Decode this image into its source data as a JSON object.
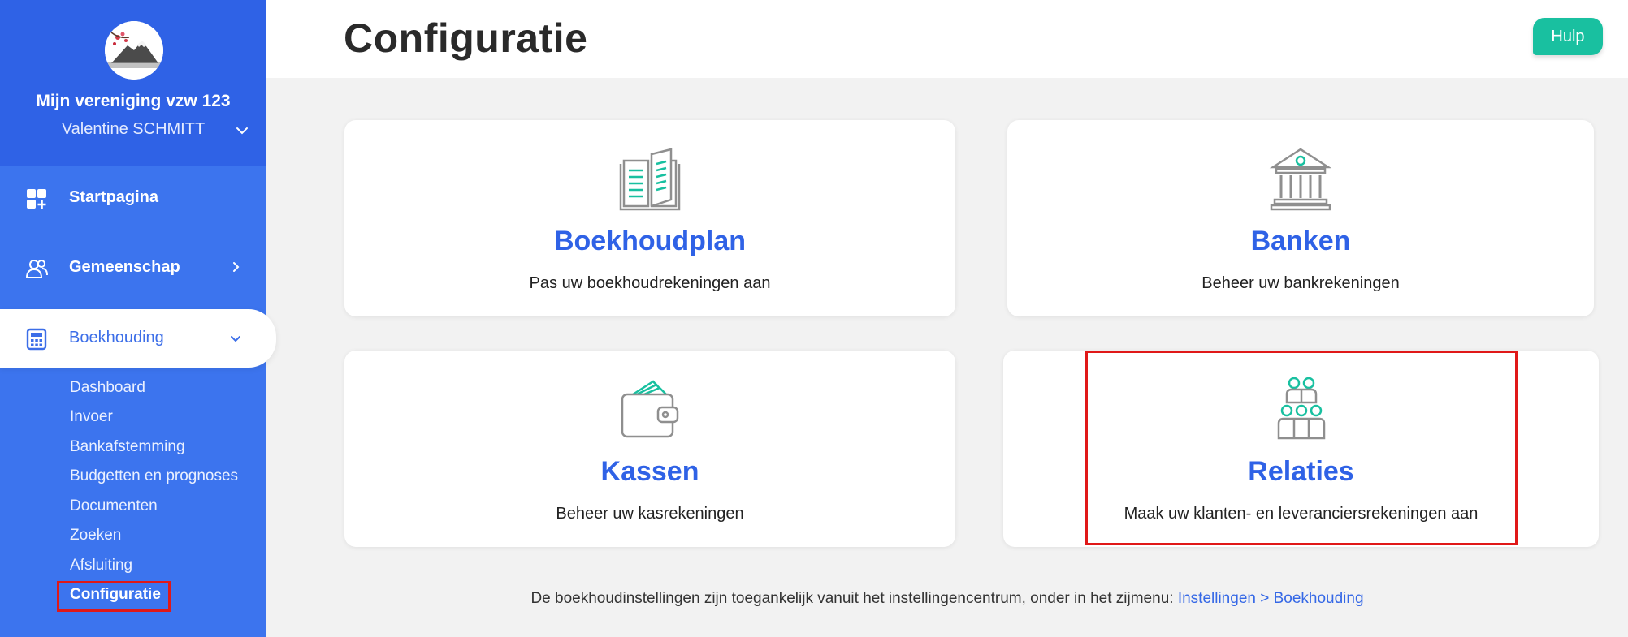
{
  "sidebar": {
    "org_name": "Mijn vereniging vzw 123",
    "user_name": "Valentine SCHMITT",
    "nav": [
      {
        "label": "Startpagina",
        "icon": "dashboard-grid-icon"
      },
      {
        "label": "Gemeenschap",
        "icon": "users-icon"
      },
      {
        "label": "Boekhouding",
        "icon": "calculator-icon"
      }
    ],
    "sub_items": [
      "Dashboard",
      "Invoer",
      "Bankafstemming",
      "Budgetten en prognoses",
      "Documenten",
      "Zoeken",
      "Afsluiting",
      "Configuratie"
    ],
    "active_sub": "Configuratie"
  },
  "header": {
    "title": "Configuratie",
    "help_label": "Hulp"
  },
  "cards": [
    {
      "title": "Boekhoudplan",
      "desc": "Pas uw boekhoudrekeningen aan",
      "icon": "ledger-book-icon"
    },
    {
      "title": "Banken",
      "desc": "Beheer uw bankrekeningen",
      "icon": "bank-building-icon"
    },
    {
      "title": "Kassen",
      "desc": "Beheer uw kasrekeningen",
      "icon": "wallet-icon"
    },
    {
      "title": "Relaties",
      "desc": "Maak uw klanten- en leveranciersrekeningen aan",
      "icon": "people-group-icon"
    }
  ],
  "footer": {
    "text": "De boekhoudinstellingen zijn toegankelijk vanuit het instellingencentrum, onder in het zijmenu: ",
    "link": "Instellingen > Boekhouding"
  },
  "colors": {
    "sidebar": "#3c74ee",
    "sidebar_top": "#2f62e6",
    "accent_blue": "#2f62e6",
    "help_green": "#19c0a0",
    "icon_teal": "#19c0a0",
    "highlight_red": "#e01818"
  }
}
